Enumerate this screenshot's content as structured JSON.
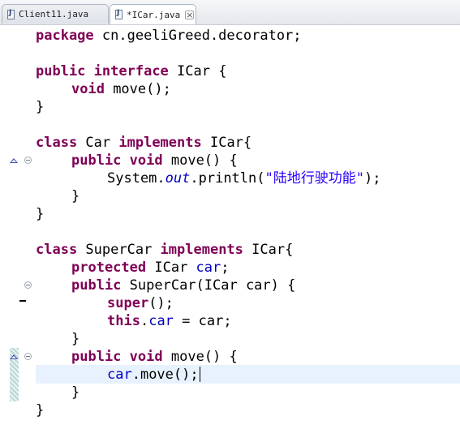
{
  "tabs": [
    {
      "label": "Client11.java",
      "active": false
    },
    {
      "label": "*ICar.java",
      "active": true
    }
  ],
  "code": {
    "l1": {
      "kw": "package",
      "rest": " cn.geeliGreed.decorator;"
    },
    "l3": {
      "kw1": "public",
      "kw2": "interface",
      "rest": " ICar {"
    },
    "l4": {
      "kw": "void",
      "rest": " move();"
    },
    "l5": {
      "text": "}"
    },
    "l7": {
      "kw1": "class",
      "name": " Car ",
      "kw2": "implements",
      "rest": " ICar{"
    },
    "l8": {
      "kw1": "public",
      "kw2": "void",
      "rest": " move() {"
    },
    "l9": {
      "pre": "System.",
      "field": "out",
      "mid": ".println(",
      "str": "\"陆地行驶功能\"",
      "post": ");"
    },
    "l10": {
      "text": "}"
    },
    "l11": {
      "text": "}"
    },
    "l13": {
      "kw1": "class",
      "name": " SuperCar ",
      "kw2": "implements",
      "rest": " ICar{"
    },
    "l14": {
      "kw": "protected",
      "mid": " ICar ",
      "field": "car",
      "post": ";"
    },
    "l15": {
      "kw": "public",
      "rest": " SuperCar(ICar car) {"
    },
    "l16": {
      "kw": "super",
      "rest": "();"
    },
    "l17": {
      "kw": "this",
      "dot": ".",
      "field": "car",
      "rest": " = car;"
    },
    "l18": {
      "text": "}"
    },
    "l19": {
      "kw1": "public",
      "kw2": "void",
      "rest": " move() {"
    },
    "l20": {
      "field": "car",
      "rest": ".move();"
    },
    "l21": {
      "text": "}"
    },
    "l22": {
      "text": "}"
    }
  },
  "colors": {
    "keyword": "#7f0055",
    "field": "#0000c0",
    "string": "#2a00ff",
    "current_line": "#e8f2fe"
  },
  "icons": [
    "java-file-icon",
    "close-icon",
    "override-triangle-icon",
    "fold-minus-icon",
    "quick-diff-change-bar"
  ]
}
